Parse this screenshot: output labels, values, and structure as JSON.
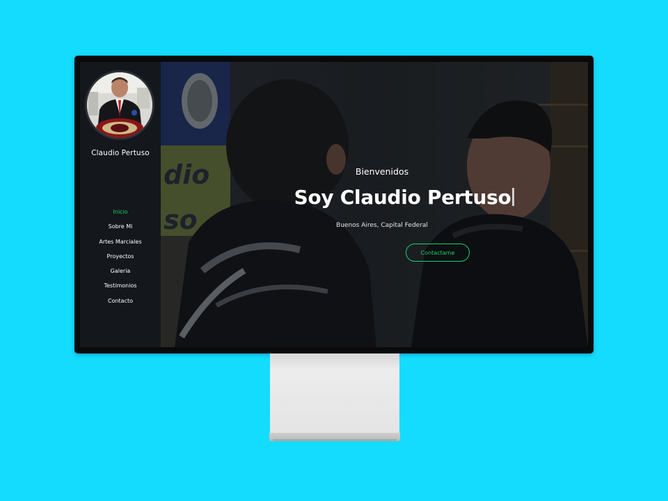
{
  "sidebar": {
    "name": "Claudio Pertuso",
    "avatar_icon": "avatar-photo-icon",
    "nav": [
      {
        "label": "Inicio",
        "active": true
      },
      {
        "label": "Sobre Mi",
        "active": false
      },
      {
        "label": "Artes Marciales",
        "active": false
      },
      {
        "label": "Proyectos",
        "active": false
      },
      {
        "label": "Galeria",
        "active": false
      },
      {
        "label": "Testimonios",
        "active": false
      },
      {
        "label": "Contacto",
        "active": false
      }
    ]
  },
  "hero": {
    "welcome": "Bienvenidos",
    "headline": "Soy Claudio Pertuso",
    "location": "Buenos Aires, Capital Federal",
    "cta_label": "Contactame"
  },
  "colors": {
    "accent": "#18d26e",
    "background": "#14dcff",
    "sidebar_bg": "#14171c"
  }
}
